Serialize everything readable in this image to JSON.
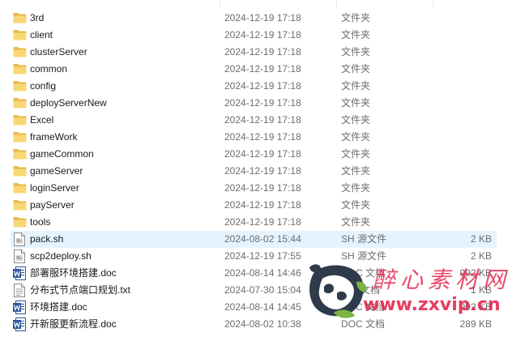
{
  "colors": {
    "folder": "#f8d775",
    "selection": "#e5f3ff",
    "word_blue": "#2b579a",
    "watermark": "#e62850"
  },
  "files": [
    {
      "name": "3rd",
      "date": "2024-12-19 17:18",
      "type": "文件夹",
      "size": "",
      "icon": "folder-icon"
    },
    {
      "name": "client",
      "date": "2024-12-19 17:18",
      "type": "文件夹",
      "size": "",
      "icon": "folder-icon"
    },
    {
      "name": "clusterServer",
      "date": "2024-12-19 17:18",
      "type": "文件夹",
      "size": "",
      "icon": "folder-icon"
    },
    {
      "name": "common",
      "date": "2024-12-19 17:18",
      "type": "文件夹",
      "size": "",
      "icon": "folder-icon"
    },
    {
      "name": "config",
      "date": "2024-12-19 17:18",
      "type": "文件夹",
      "size": "",
      "icon": "folder-icon"
    },
    {
      "name": "deployServerNew",
      "date": "2024-12-19 17:18",
      "type": "文件夹",
      "size": "",
      "icon": "folder-icon"
    },
    {
      "name": "Excel",
      "date": "2024-12-19 17:18",
      "type": "文件夹",
      "size": "",
      "icon": "folder-icon"
    },
    {
      "name": "frameWork",
      "date": "2024-12-19 17:18",
      "type": "文件夹",
      "size": "",
      "icon": "folder-icon"
    },
    {
      "name": "gameCommon",
      "date": "2024-12-19 17:18",
      "type": "文件夹",
      "size": "",
      "icon": "folder-icon"
    },
    {
      "name": "gameServer",
      "date": "2024-12-19 17:18",
      "type": "文件夹",
      "size": "",
      "icon": "folder-icon"
    },
    {
      "name": "loginServer",
      "date": "2024-12-19 17:18",
      "type": "文件夹",
      "size": "",
      "icon": "folder-icon"
    },
    {
      "name": "payServer",
      "date": "2024-12-19 17:18",
      "type": "文件夹",
      "size": "",
      "icon": "folder-icon"
    },
    {
      "name": "tools",
      "date": "2024-12-19 17:18",
      "type": "文件夹",
      "size": "",
      "icon": "folder-icon"
    },
    {
      "name": "pack.sh",
      "date": "2024-08-02 15:44",
      "type": "SH 源文件",
      "size": "2 KB",
      "icon": "sh-file-icon",
      "selected": true
    },
    {
      "name": "scp2deploy.sh",
      "date": "2024-12-19 17:55",
      "type": "SH 源文件",
      "size": "2 KB",
      "icon": "sh-file-icon"
    },
    {
      "name": "部署服环境搭建.doc",
      "date": "2024-08-14 14:46",
      "type": "DOC 文档",
      "size": "992 KB",
      "icon": "word-doc-icon"
    },
    {
      "name": "分布式节点端口规划.txt",
      "date": "2024-07-30 15:04",
      "type": "文本文档",
      "size": "1 KB",
      "icon": "text-file-icon"
    },
    {
      "name": "环境搭建.doc",
      "date": "2024-08-14 14:45",
      "type": "DOC 文档",
      "size": "992 KB",
      "icon": "word-doc-icon"
    },
    {
      "name": "开新服更新流程.doc",
      "date": "2024-08-02 10:38",
      "type": "DOC 文档",
      "size": "289 KB",
      "icon": "word-doc-icon"
    }
  ],
  "watermark": {
    "title": "醉心素材网",
    "url": "www.zxvip.cn"
  }
}
